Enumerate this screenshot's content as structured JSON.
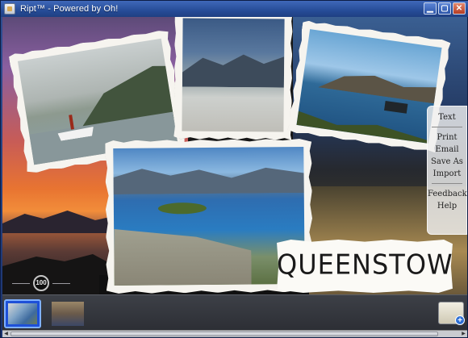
{
  "window": {
    "title": "Ript™ - Powered by Oh!",
    "controls": {
      "minimize": "▁",
      "maximize": "▢",
      "close": "✕"
    }
  },
  "caption": {
    "text": "QUEENSTOWN"
  },
  "badge": {
    "text": "100"
  },
  "side_menu": {
    "items": [
      "Text",
      "Print",
      "Email",
      "Save As",
      "Import",
      "Feedback",
      "Help"
    ]
  },
  "filmstrip": {
    "thumbnails": [
      {
        "selected": true
      },
      {
        "selected": false
      }
    ],
    "add_icon": "plus-icon"
  }
}
